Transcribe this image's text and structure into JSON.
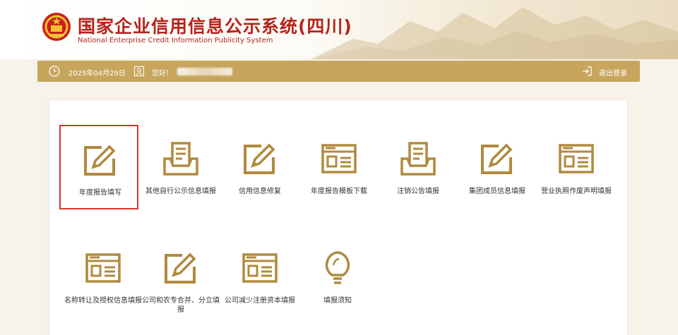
{
  "header": {
    "title_cn": "国家企业信用信息公示系统(四川)",
    "title_en": "National Enterprise Credit Information Publicity System"
  },
  "topbar": {
    "date": "2025年04月29日",
    "greeting": "您好！",
    "logout_label": "退出登录"
  },
  "colors": {
    "accent": "#c8a55d",
    "icon": "#b08a3e",
    "title": "#b4241c",
    "selected_border": "#e0322a"
  },
  "tiles": [
    {
      "label": "年度报告填写",
      "icon": "edit-icon"
    },
    {
      "label": "其他自行公示信息填报",
      "icon": "tray-icon"
    },
    {
      "label": "信用信息修复",
      "icon": "edit-icon"
    },
    {
      "label": "年度报告模板下载",
      "icon": "document-window-icon"
    },
    {
      "label": "注销公告填报",
      "icon": "tray-icon"
    },
    {
      "label": "集团成员信息填报",
      "icon": "edit-icon"
    },
    {
      "label": "营业执照作废声明填报",
      "icon": "document-window-icon"
    },
    {
      "label": "名称转让及授权信息填报",
      "icon": "document-window-icon"
    },
    {
      "label": "公司和农专合并、分立填报",
      "icon": "edit-icon"
    },
    {
      "label": "公司减少注册资本填报",
      "icon": "document-window-icon"
    },
    {
      "label": "填报须知",
      "icon": "lightbulb-icon"
    }
  ]
}
